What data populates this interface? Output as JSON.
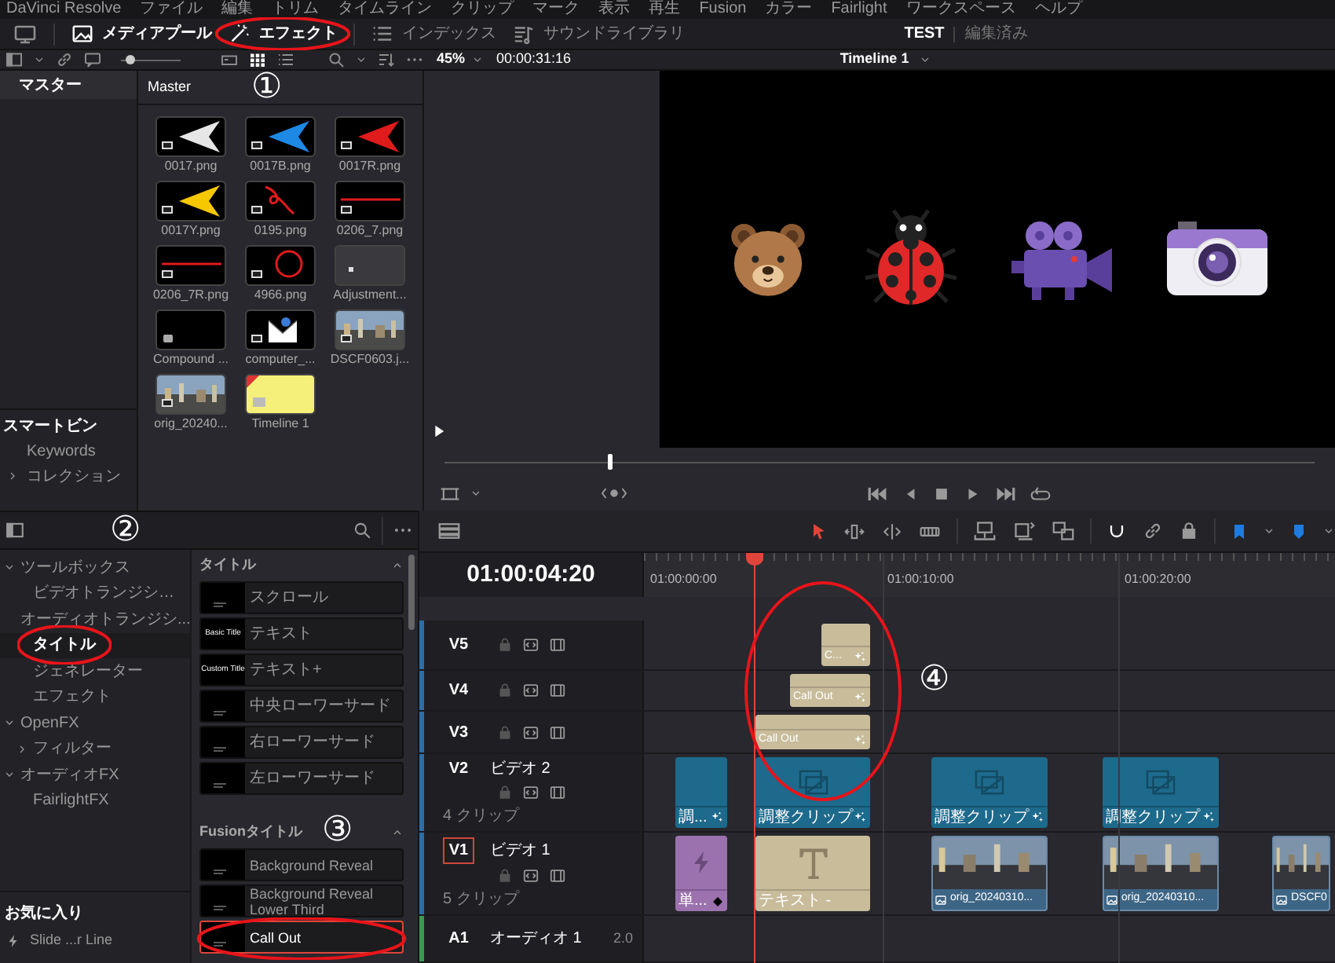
{
  "menu_bar": {
    "app_name": "DaVinci Resolve",
    "items": [
      "ファイル",
      "編集",
      "トリム",
      "タイムライン",
      "クリップ",
      "マーク",
      "表示",
      "再生",
      "Fusion",
      "カラー",
      "Fairlight",
      "ワークスペース",
      "ヘルプ"
    ]
  },
  "toolbar": {
    "items": [
      {
        "kind": "media",
        "label": "メディアプール",
        "selected": true
      },
      {
        "kind": "effects",
        "label": "エフェクト",
        "selected": true
      },
      {
        "kind": "index",
        "label": "インデックス",
        "selected": false
      },
      {
        "kind": "sound",
        "label": "サウンドライブラリ",
        "selected": false
      }
    ],
    "project": "TEST",
    "project_status": "編集済み"
  },
  "media_pool": {
    "thumb_size": {
      "level": 0.15
    },
    "bins": [
      {
        "label": "マスター",
        "selected": true
      }
    ],
    "smart_bins_title": "スマートビン",
    "smart_bins": [
      {
        "label": "Keywords"
      },
      {
        "label": "コレクション",
        "expanded": false
      }
    ],
    "bin_title": "Master",
    "clips": [
      {
        "name": "0017.png",
        "kind": "arrow",
        "color": "#e6e6e6"
      },
      {
        "name": "0017B.png",
        "kind": "arrow",
        "color": "#1e88e5"
      },
      {
        "name": "0017R.png",
        "kind": "arrow",
        "color": "#e01b1b"
      },
      {
        "name": "0017Y.png",
        "kind": "arrow",
        "color": "#f5c800"
      },
      {
        "name": "0195.png",
        "kind": "squiggle"
      },
      {
        "name": "0206_7.png",
        "kind": "line"
      },
      {
        "name": "0206_7R.png",
        "kind": "line"
      },
      {
        "name": "4966.png",
        "kind": "circle"
      },
      {
        "name": "Adjustment...",
        "kind": "adjustment"
      },
      {
        "name": "Compound ...",
        "kind": "compound"
      },
      {
        "name": "computer_...",
        "kind": "mail"
      },
      {
        "name": "DSCF0603.j...",
        "kind": "photo"
      },
      {
        "name": "orig_20240...",
        "kind": "photo"
      },
      {
        "name": "Timeline 1",
        "kind": "timeline"
      }
    ]
  },
  "viewer": {
    "zoom": "45%",
    "source_timecode": "00:00:31:16",
    "timeline_name": "Timeline 1",
    "scrubber": {
      "level": 0.19
    }
  },
  "effects": {
    "tree": [
      {
        "label": "ツールボックス",
        "expanded": true,
        "selected": false,
        "children": [
          {
            "label": "ビデオトランジシ…",
            "selected": false
          },
          {
            "label": "オーディオトランジシ...",
            "selected": false
          },
          {
            "label": "タイトル",
            "selected": true
          },
          {
            "label": "ジェネレーター",
            "selected": false
          },
          {
            "label": "エフェクト",
            "selected": false
          }
        ]
      },
      {
        "label": "OpenFX",
        "expanded": true,
        "selected": false,
        "children": [
          {
            "label": "フィルター",
            "expanded": false,
            "selected": false
          }
        ]
      },
      {
        "label": "オーディオFX",
        "expanded": true,
        "selected": false,
        "children": [
          {
            "label": "FairlightFX",
            "selected": false
          }
        ]
      }
    ],
    "sections": [
      {
        "title": "タイトル",
        "expanded": true,
        "items": [
          {
            "label": "スクロール",
            "selected": false
          },
          {
            "label": "テキスト",
            "thumb_text": "Basic Title",
            "selected": false
          },
          {
            "label": "テキスト+",
            "thumb_text": "Custom Title",
            "selected": false
          },
          {
            "label": "中央ローワーサード",
            "selected": false
          },
          {
            "label": "右ローワーサード",
            "selected": false
          },
          {
            "label": "左ローワーサード",
            "selected": false
          }
        ]
      },
      {
        "title": "Fusionタイトル",
        "expanded": true,
        "items": [
          {
            "label": "Background Reveal",
            "selected": false
          },
          {
            "label": "Background Reveal Lower Third",
            "selected": false
          },
          {
            "label": "Call Out",
            "selected": true
          }
        ]
      }
    ],
    "favorites_title": "お気に入り",
    "favorites": [
      {
        "label": "Slide ...r Line"
      }
    ]
  },
  "timeline": {
    "timecode": "01:00:04:20",
    "ruler": [
      "01:00:00:00",
      "01:00:10:00",
      "01:00:20:00"
    ],
    "tracks": [
      {
        "name": "V5",
        "kind": "video",
        "selected": false,
        "clips": [
          {
            "kind": "title",
            "label": "C..."
          }
        ]
      },
      {
        "name": "V4",
        "kind": "video",
        "selected": false,
        "clips": [
          {
            "kind": "title",
            "label": "Call Out"
          }
        ]
      },
      {
        "name": "V3",
        "kind": "video",
        "selected": false,
        "clips": [
          {
            "kind": "title",
            "label": "Call Out"
          }
        ]
      },
      {
        "name": "V2",
        "kind": "video",
        "title": "ビデオ 2",
        "count": "4 クリップ",
        "selected": false,
        "clips": [
          {
            "kind": "adjustment",
            "label": "調..."
          },
          {
            "kind": "adjustment",
            "label": "調整クリップ"
          },
          {
            "kind": "adjustment",
            "label": "調整クリップ"
          },
          {
            "kind": "adjustment",
            "label": "調整クリップ"
          }
        ]
      },
      {
        "name": "V1",
        "kind": "video",
        "title": "ビデオ 1",
        "count": "5 クリップ",
        "selected": true,
        "clips": [
          {
            "kind": "generator",
            "label": "単..."
          },
          {
            "kind": "text",
            "label": "テキスト -"
          },
          {
            "kind": "photo",
            "label": "orig_20240310..."
          },
          {
            "kind": "photo",
            "label": "orig_20240310..."
          },
          {
            "kind": "photo",
            "label": "DSCF0"
          }
        ]
      },
      {
        "name": "A1",
        "kind": "audio",
        "title": "オーディオ 1",
        "channels": "2.0",
        "selected": false
      }
    ]
  },
  "annotations": [
    {
      "label": "①"
    },
    {
      "label": "②"
    },
    {
      "label": "③"
    },
    {
      "label": "④"
    }
  ]
}
